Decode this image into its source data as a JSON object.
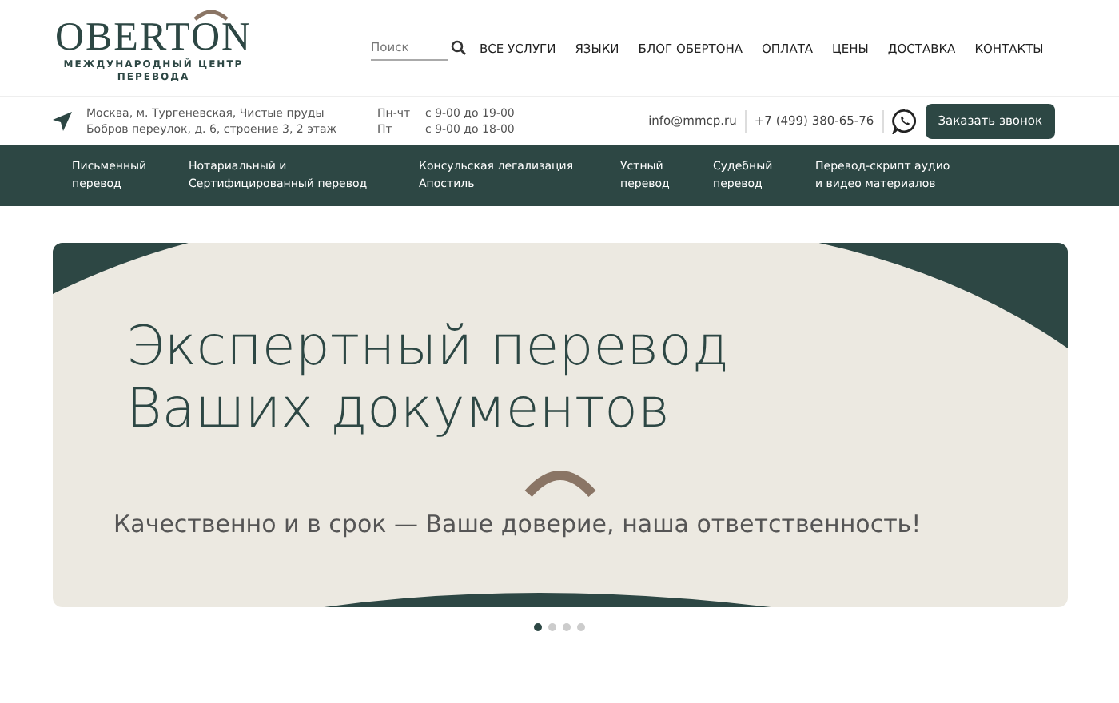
{
  "logo": {
    "name": "OBERTON",
    "subtitle": "МЕЖДУНАРОДНЫЙ ЦЕНТР\nПЕРЕВОДА"
  },
  "search": {
    "placeholder": "Поиск"
  },
  "menu": [
    "ВСЕ УСЛУГИ",
    "ЯЗЫКИ",
    "БЛОГ ОБЕРТОНА",
    "ОПЛАТА",
    "ЦЕНЫ",
    "ДОСТАВКА",
    "КОНТАКТЫ"
  ],
  "address": "Москва, м. Тургеневская, Чистые пруды\nБобров переулок, д. 6, строение 3, 2 этаж",
  "hours": [
    {
      "days": "Пн-чт",
      "time": "с 9-00 до 19-00"
    },
    {
      "days": "Пт",
      "time": "с 9-00 до 18-00"
    }
  ],
  "email": "info@mmcp.ru",
  "phone": "+7 (499) 380-65-76",
  "callback_button": "Заказать звонок",
  "services": [
    "Письменный\nперевод",
    "Нотариальный и\nСертифицированный перевод",
    "Консульская легализация\nАпостиль",
    "Устный\nперевод",
    "Судебный\nперевод",
    "Перевод-скрипт аудио\nи видео материалов"
  ],
  "banner": {
    "title": "Экспертный перевод\nВаших документов",
    "subtitle": "Качественно и в срок — Ваше доверие, наша ответственность!"
  },
  "slides": [
    {
      "selected": true
    },
    {
      "selected": false
    },
    {
      "selected": false
    },
    {
      "selected": false
    }
  ]
}
